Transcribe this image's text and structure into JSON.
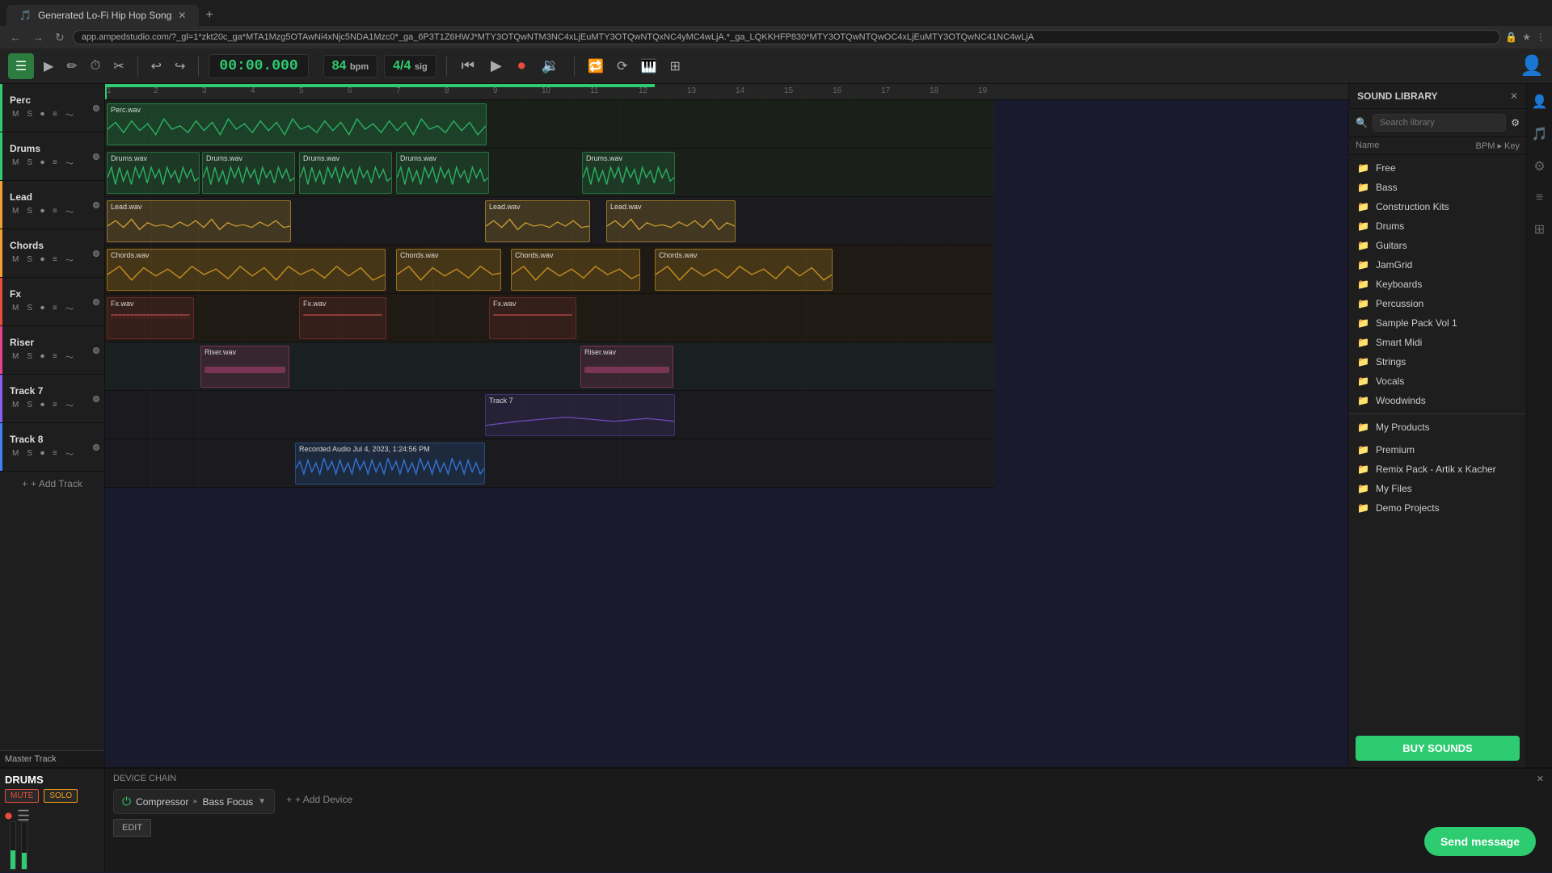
{
  "browser": {
    "tab_title": "Generated Lo-Fi Hip Hop Song",
    "url": "app.ampedstudio.com/?_gl=1*zkt20c_ga*MTA1Mzg5OTAwNi4xNjc5NDA1Mzc0*_ga_6P3T1Z6HWJ*MTY3OTQwNTM3NC4xLjEuMTY3OTQwNTQxNC4yMC4wLjA.*_ga_LQKKHFP830*MTY3OTQwNTQwOC4xLjEuMTY3OTQwNC41NC4wLjA"
  },
  "app": {
    "title": "Generated Lo-Fi Hip Hop Song",
    "time": "00:00.000",
    "bpm": "84",
    "bpm_unit": "bpm",
    "time_sig": "4/4",
    "time_sig_unit": "sig"
  },
  "tracks": [
    {
      "id": "perc",
      "name": "Perc",
      "color": "#2ecc71",
      "muted": false,
      "soloed": false
    },
    {
      "id": "drums",
      "name": "Drums",
      "color": "#2ecc71",
      "muted": false,
      "soloed": false
    },
    {
      "id": "lead",
      "name": "Lead",
      "color": "#f0a030",
      "muted": false,
      "soloed": false
    },
    {
      "id": "chords",
      "name": "Chords",
      "color": "#f0a030",
      "muted": false,
      "soloed": false
    },
    {
      "id": "fx",
      "name": "Fx",
      "color": "#e74c3c",
      "muted": false,
      "soloed": false
    },
    {
      "id": "riser",
      "name": "Riser",
      "color": "#e84393",
      "muted": false,
      "soloed": false
    },
    {
      "id": "track7",
      "name": "Track 7",
      "color": "#8b5cf6",
      "muted": false,
      "soloed": false
    },
    {
      "id": "track8",
      "name": "Track 8",
      "color": "#3b82f6",
      "muted": false,
      "soloed": false
    }
  ],
  "toolbar": {
    "add_track": "+ Add Track",
    "master_track": "Master Track"
  },
  "sound_library": {
    "title": "SOUND LIBRARY",
    "search_placeholder": "Search library",
    "col_name": "Name",
    "col_bpm": "BPM",
    "col_key": "Key",
    "items": [
      {
        "name": "Free",
        "type": "folder"
      },
      {
        "name": "Bass",
        "type": "folder"
      },
      {
        "name": "Construction Kits",
        "type": "folder"
      },
      {
        "name": "Drums",
        "type": "folder"
      },
      {
        "name": "Guitars",
        "type": "folder"
      },
      {
        "name": "JamGrid",
        "type": "folder"
      },
      {
        "name": "Keyboards",
        "type": "folder"
      },
      {
        "name": "Percussion",
        "type": "folder"
      },
      {
        "name": "Sample Pack Vol 1",
        "type": "folder"
      },
      {
        "name": "Smart Midi",
        "type": "folder"
      },
      {
        "name": "Strings",
        "type": "folder"
      },
      {
        "name": "Vocals",
        "type": "folder"
      },
      {
        "name": "Woodwinds",
        "type": "folder"
      },
      {
        "name": "My Products",
        "type": "folder",
        "section": true
      },
      {
        "name": "Premium",
        "type": "folder"
      },
      {
        "name": "Remix Pack - Artik x Kacher",
        "type": "folder"
      },
      {
        "name": "My Files",
        "type": "folder"
      },
      {
        "name": "Demo Projects",
        "type": "folder"
      }
    ],
    "buy_btn": "BUY SOUNDS"
  },
  "device_chain": {
    "title": "DEVICE CHAIN",
    "track": "DRUMS",
    "mute_label": "MUTE",
    "solo_label": "SOLO",
    "devices": [
      {
        "name": "Compressor",
        "enabled": true
      },
      {
        "name": "Bass Focus",
        "enabled": true
      }
    ],
    "edit_label": "EDIT",
    "add_device_label": "+ Add Device"
  },
  "chat": {
    "send_message": "Send message"
  },
  "ruler": {
    "marks": [
      "1",
      "2",
      "3",
      "4",
      "5",
      "6",
      "7",
      "8",
      "9",
      "10",
      "11",
      "12",
      "13",
      "14",
      "15",
      "16",
      "17",
      "18",
      "19"
    ]
  }
}
